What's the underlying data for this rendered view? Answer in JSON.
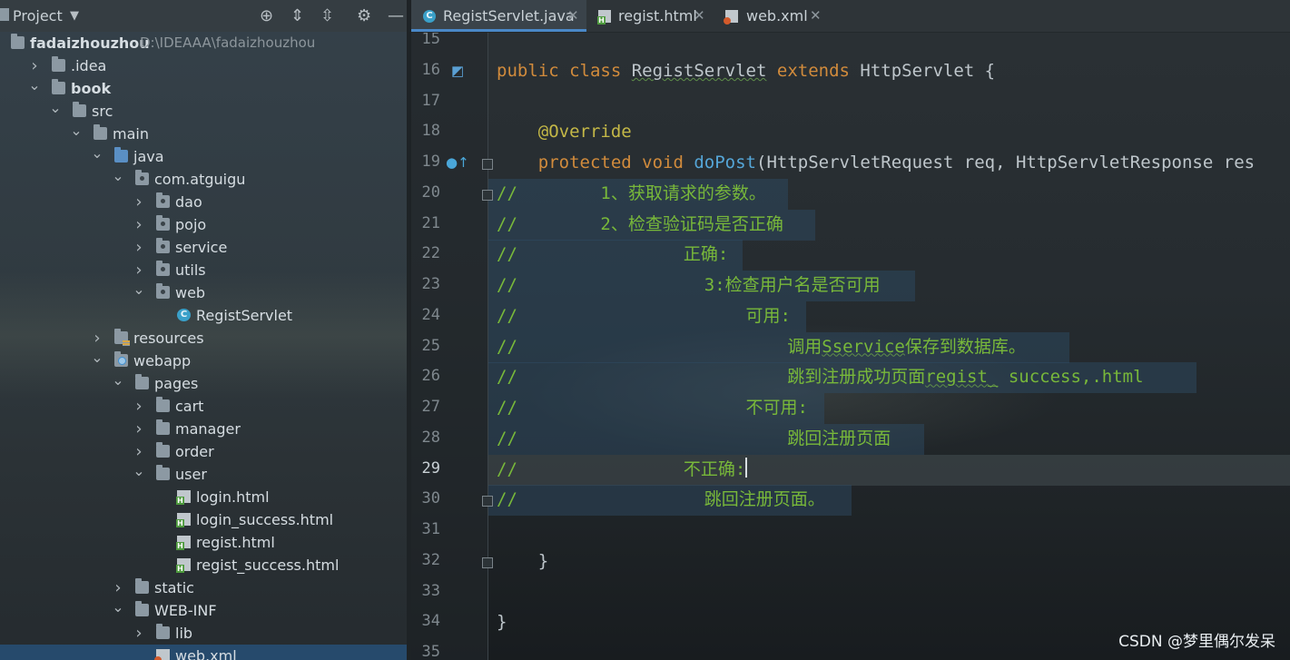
{
  "project_panel": {
    "title": "Project",
    "root_name": "fadaizhouzhou",
    "root_path": "D:\\IDEAAA\\fadaizhouzhou",
    "tree": [
      {
        "label": "fadaizhouzhou",
        "path": "D:\\IDEAAA\\fadaizhouzhou",
        "icon": "module-folder-icon",
        "chevron": ""
      },
      {
        "label": ".idea",
        "icon": "folder-icon",
        "chevron": "collapsed"
      },
      {
        "label": "book",
        "icon": "module-folder-icon",
        "chevron": "expanded"
      },
      {
        "label": "src",
        "icon": "folder-icon",
        "chevron": "expanded"
      },
      {
        "label": "main",
        "icon": "folder-icon",
        "chevron": "expanded"
      },
      {
        "label": "java",
        "icon": "source-folder-icon",
        "chevron": "expanded"
      },
      {
        "label": "com.atguigu",
        "icon": "package-icon",
        "chevron": "expanded"
      },
      {
        "label": "dao",
        "icon": "package-icon",
        "chevron": "collapsed"
      },
      {
        "label": "pojo",
        "icon": "package-icon",
        "chevron": "collapsed"
      },
      {
        "label": "service",
        "icon": "package-icon",
        "chevron": "collapsed"
      },
      {
        "label": "utils",
        "icon": "package-icon",
        "chevron": "collapsed"
      },
      {
        "label": "web",
        "icon": "package-icon",
        "chevron": "expanded"
      },
      {
        "label": "RegistServlet",
        "icon": "java-class-icon",
        "chevron": ""
      },
      {
        "label": "resources",
        "icon": "resources-folder-icon",
        "chevron": "collapsed"
      },
      {
        "label": "webapp",
        "icon": "web-folder-icon",
        "chevron": "expanded"
      },
      {
        "label": "pages",
        "icon": "folder-icon",
        "chevron": "expanded"
      },
      {
        "label": "cart",
        "icon": "folder-icon",
        "chevron": "collapsed"
      },
      {
        "label": "manager",
        "icon": "folder-icon",
        "chevron": "collapsed"
      },
      {
        "label": "order",
        "icon": "folder-icon",
        "chevron": "collapsed"
      },
      {
        "label": "user",
        "icon": "folder-icon",
        "chevron": "expanded"
      },
      {
        "label": "login.html",
        "icon": "html-file-icon",
        "chevron": ""
      },
      {
        "label": "login_success.html",
        "icon": "html-file-icon",
        "chevron": ""
      },
      {
        "label": "regist.html",
        "icon": "html-file-icon",
        "chevron": ""
      },
      {
        "label": "regist_success.html",
        "icon": "html-file-icon",
        "chevron": ""
      },
      {
        "label": "static",
        "icon": "folder-icon",
        "chevron": "collapsed"
      },
      {
        "label": "WEB-INF",
        "icon": "folder-icon",
        "chevron": "expanded"
      },
      {
        "label": "lib",
        "icon": "folder-icon",
        "chevron": "collapsed"
      },
      {
        "label": "web.xml",
        "icon": "xml-file-icon",
        "chevron": "",
        "selected": true
      }
    ],
    "header_icons": [
      "locate-icon",
      "expand-all-icon",
      "collapse-all-icon",
      "gear-icon",
      "minimize-icon"
    ]
  },
  "tabs": [
    {
      "label": "RegistServlet.java",
      "icon": "java-class-icon",
      "active": true
    },
    {
      "label": "regist.html",
      "icon": "html-file-icon",
      "active": false
    },
    {
      "label": "web.xml",
      "icon": "xml-file-icon",
      "active": false
    }
  ],
  "editor": {
    "current_line": "29",
    "lines": [
      {
        "n": "15",
        "tokens": []
      },
      {
        "n": "16",
        "tokens": [
          [
            "kw",
            "public class "
          ],
          [
            "cls",
            "RegistServlet"
          ],
          [
            "kw",
            " extends "
          ],
          [
            "plain",
            "HttpServlet {"
          ]
        ]
      },
      {
        "n": "17",
        "tokens": []
      },
      {
        "n": "18",
        "tokens": [
          [
            "plain",
            "    "
          ],
          [
            "ann",
            "@Override"
          ]
        ]
      },
      {
        "n": "19",
        "tokens": [
          [
            "plain",
            "    "
          ],
          [
            "kw",
            "protected void "
          ],
          [
            "meth",
            "doPost"
          ],
          [
            "plain",
            "(HttpServletRequest req, HttpServletResponse res"
          ]
        ]
      },
      {
        "n": "20",
        "tokens": [
          [
            "comment",
            "//        1、获取请求的参数。"
          ]
        ]
      },
      {
        "n": "21",
        "tokens": [
          [
            "comment",
            "//        2、检查验证码是否正确"
          ]
        ]
      },
      {
        "n": "22",
        "tokens": [
          [
            "comment",
            "//                正确:"
          ]
        ]
      },
      {
        "n": "23",
        "tokens": [
          [
            "comment",
            "//                  3:检查用户名是否可用"
          ]
        ]
      },
      {
        "n": "24",
        "tokens": [
          [
            "comment",
            "//                      可用:"
          ]
        ]
      },
      {
        "n": "25",
        "tokens": [
          [
            "comment",
            "//                          调用"
          ],
          [
            "commentwavy",
            "Sservice"
          ],
          [
            "comment",
            "保存到数据库。"
          ]
        ]
      },
      {
        "n": "26",
        "tokens": [
          [
            "comment",
            "//                          跳到注册成功页面"
          ],
          [
            "commentwavy",
            "regist_"
          ],
          [
            "comment",
            " success,.html"
          ]
        ]
      },
      {
        "n": "27",
        "tokens": [
          [
            "comment",
            "//                      不可用:"
          ]
        ]
      },
      {
        "n": "28",
        "tokens": [
          [
            "comment",
            "//                          跳回注册页面"
          ]
        ]
      },
      {
        "n": "29",
        "tokens": [
          [
            "comment",
            "//                不正确:"
          ]
        ]
      },
      {
        "n": "30",
        "tokens": [
          [
            "comment",
            "//                  跳回注册页面。"
          ]
        ]
      },
      {
        "n": "31",
        "tokens": []
      },
      {
        "n": "32",
        "tokens": [
          [
            "plain",
            "    }"
          ]
        ]
      },
      {
        "n": "33",
        "tokens": []
      },
      {
        "n": "34",
        "tokens": [
          [
            "plain",
            "}"
          ]
        ]
      },
      {
        "n": "35",
        "tokens": []
      }
    ]
  },
  "watermark": "CSDN @梦里偶尔发呆",
  "colors": {
    "keyword": "#d18b3c",
    "comment": "#78b83a",
    "method": "#55a6d8",
    "annotation": "#c4b847",
    "selection": "#264a6c"
  }
}
